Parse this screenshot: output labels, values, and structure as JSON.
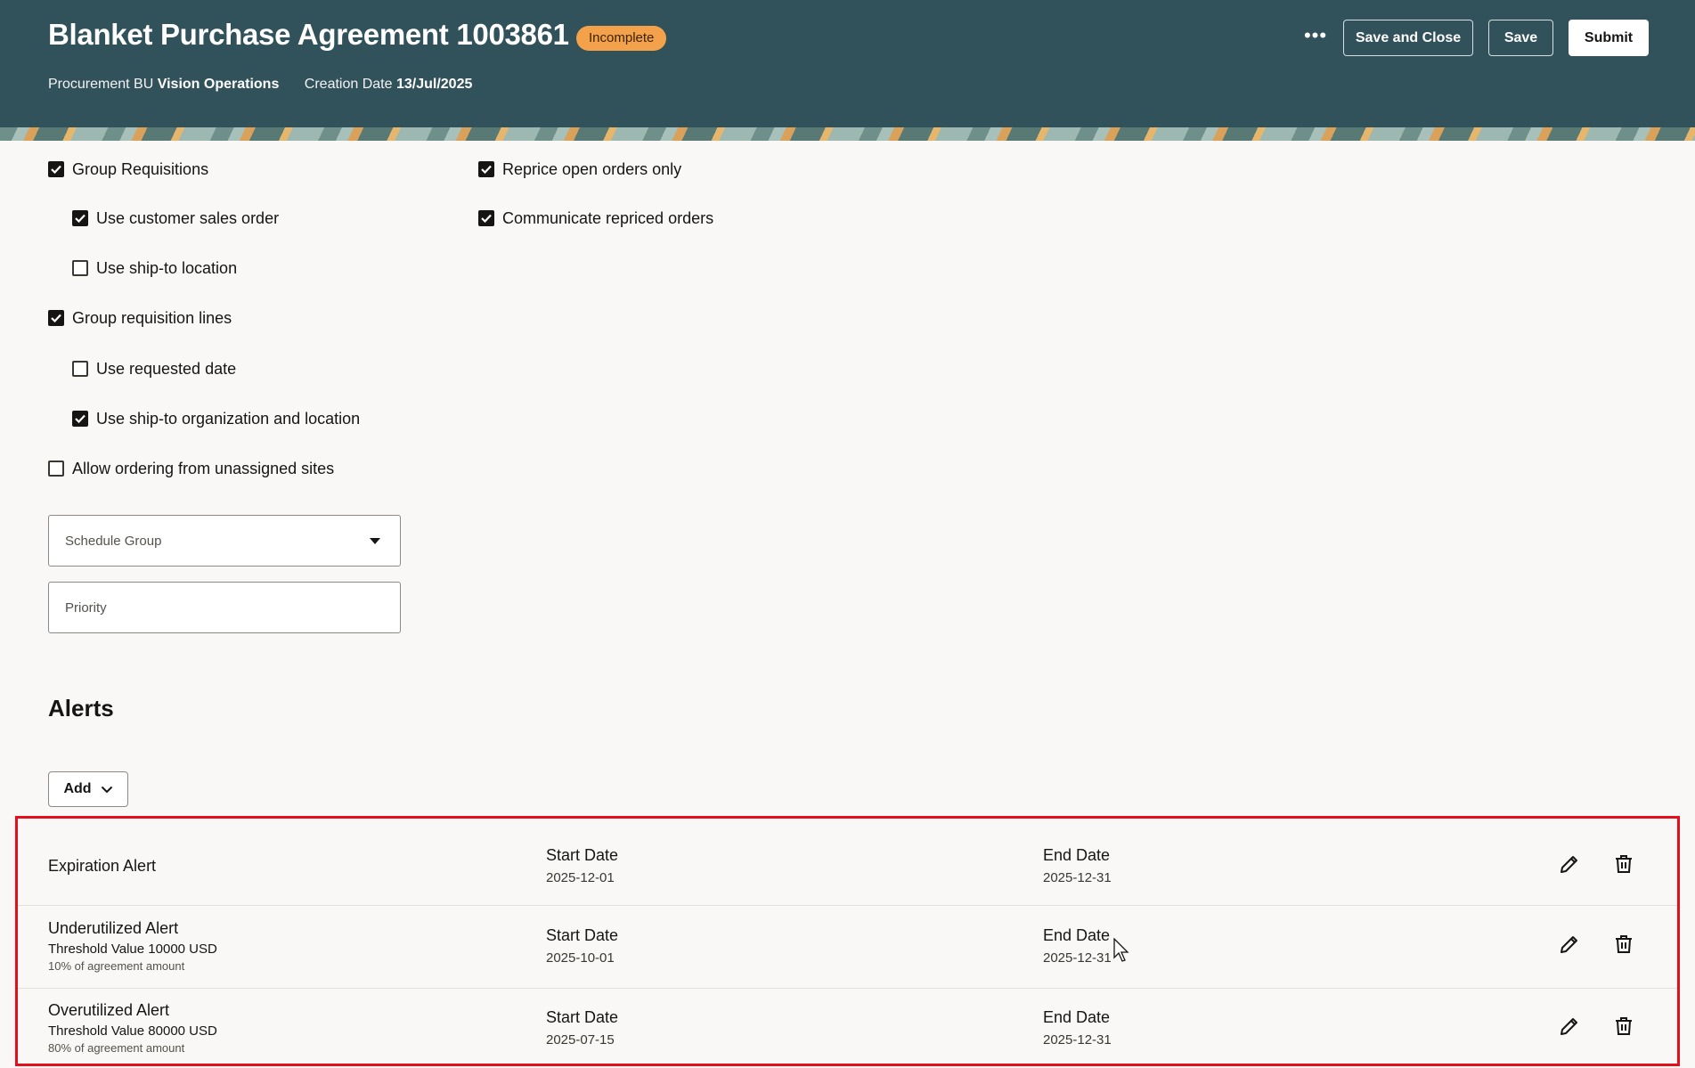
{
  "header": {
    "title": "Blanket Purchase Agreement 1003861",
    "status": "Incomplete",
    "procurement_bu_label": "Procurement BU",
    "procurement_bu_value": "Vision Operations",
    "creation_date_label": "Creation Date",
    "creation_date_value": "13/Jul/2025",
    "more_label": "•••",
    "save_close_label": "Save and Close",
    "save_label": "Save",
    "submit_label": "Submit"
  },
  "options": {
    "group_requisitions": {
      "label": "Group Requisitions",
      "checked": true
    },
    "use_customer_sales_order": {
      "label": "Use customer sales order",
      "checked": true
    },
    "use_ship_to_location": {
      "label": "Use ship-to location",
      "checked": false
    },
    "group_requisition_lines": {
      "label": "Group requisition lines",
      "checked": true
    },
    "use_requested_date": {
      "label": "Use requested date",
      "checked": false
    },
    "use_ship_to_org_location": {
      "label": "Use ship-to organization and location",
      "checked": true
    },
    "allow_unassigned_sites": {
      "label": "Allow ordering from unassigned sites",
      "checked": false
    },
    "reprice_open_orders": {
      "label": "Reprice open orders only",
      "checked": true
    },
    "communicate_repriced": {
      "label": "Communicate repriced orders",
      "checked": true
    }
  },
  "fields": {
    "schedule_group": {
      "label": "Schedule Group",
      "value": ""
    },
    "priority": {
      "label": "Priority",
      "value": ""
    }
  },
  "alerts": {
    "title": "Alerts",
    "add_label": "Add",
    "rows": [
      {
        "name": "Expiration Alert",
        "threshold": "",
        "percent": "",
        "start_label": "Start Date",
        "start_value": "2025-12-01",
        "end_label": "End Date",
        "end_value": "2025-12-31"
      },
      {
        "name": "Underutilized Alert",
        "threshold": "Threshold Value 10000 USD",
        "percent": "10% of agreement amount",
        "start_label": "Start Date",
        "start_value": "2025-10-01",
        "end_label": "End Date",
        "end_value": "2025-12-31"
      },
      {
        "name": "Overutilized Alert",
        "threshold": "Threshold Value 80000 USD",
        "percent": "80% of agreement amount",
        "start_label": "Start Date",
        "start_value": "2025-07-15",
        "end_label": "End Date",
        "end_value": "2025-12-31"
      }
    ]
  },
  "icons": {
    "edit": "pencil-icon",
    "delete": "trash-icon",
    "add_dropdown": "chevron-down-icon",
    "select_caret": "caret-down-icon"
  },
  "colors": {
    "header_bg": "#32525b",
    "status_badge": "#f3a24b",
    "highlight_border": "#e3101c",
    "page_bg": "#f9f8f6"
  }
}
